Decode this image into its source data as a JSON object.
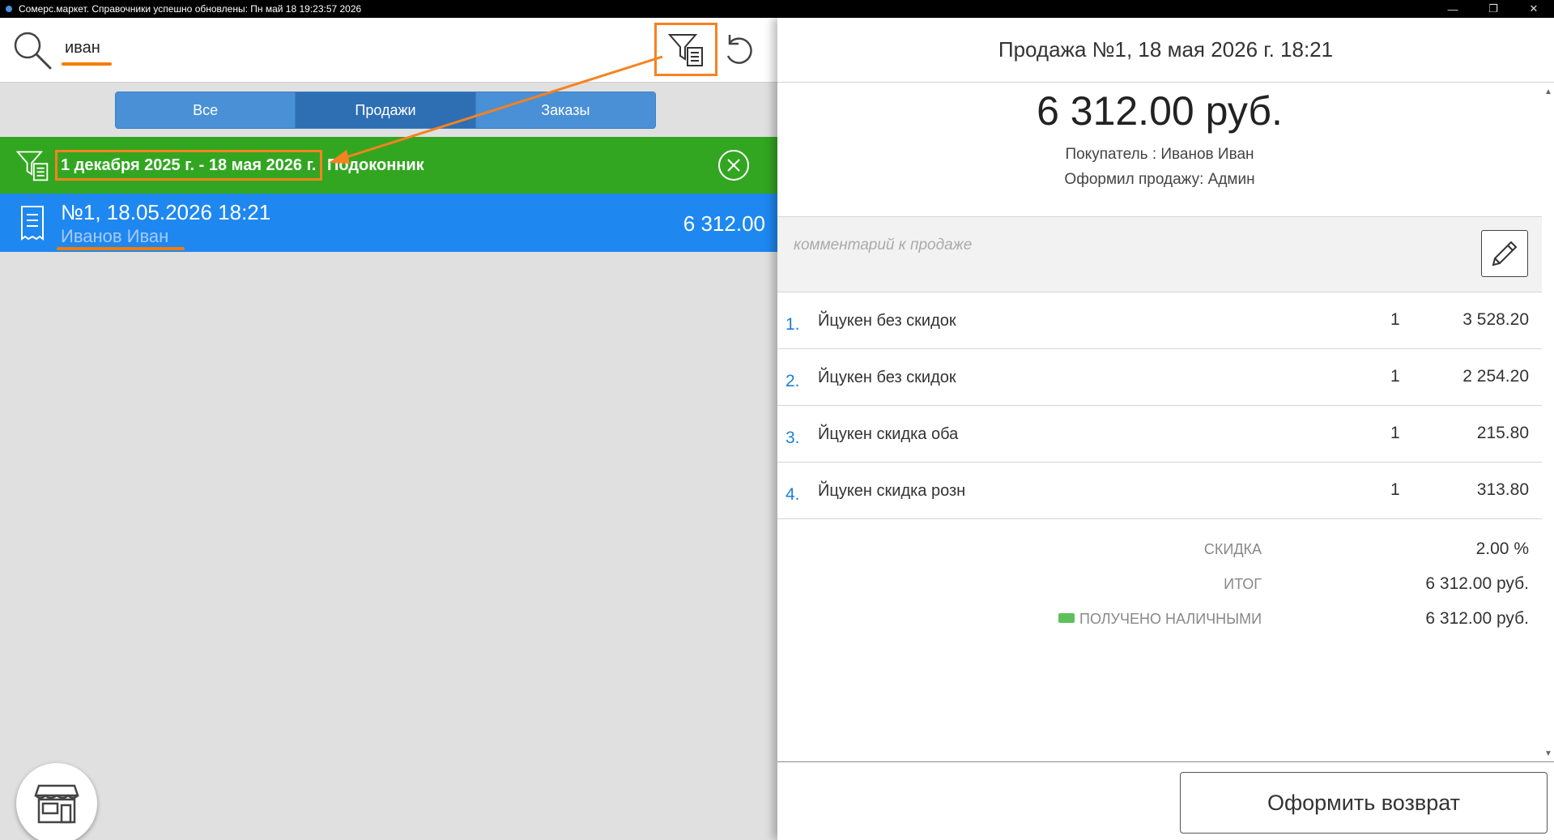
{
  "window": {
    "title": "Сомерс.маркет. Справочники успешно обновлены: Пн май 18 19:23:57 2026",
    "minimize": "—",
    "maximize": "❐",
    "close": "✕"
  },
  "search": {
    "query": "иван"
  },
  "tabs": [
    {
      "label": "Все",
      "active": false
    },
    {
      "label": "Продажи",
      "active": true
    },
    {
      "label": "Заказы",
      "active": false
    }
  ],
  "filter": {
    "date_range": "1 декабря 2025 г. - 18 мая 2026 г.",
    "place": "Подоконник"
  },
  "sale_list": [
    {
      "title": "№1, 18.05.2026 18:21",
      "buyer": "Иванов Иван",
      "sum": "6 312.00"
    }
  ],
  "detail": {
    "header": "Продажа №1, 18 мая 2026 г. 18:21",
    "total": "6 312.00 руб.",
    "buyer": "Покупатель : Иванов Иван",
    "seller": "Оформил продажу: Админ",
    "comment_placeholder": "комментарий к продаже",
    "items": [
      {
        "num": "1.",
        "name": "Йцукен без скидок",
        "qty": "1",
        "sum": "3 528.20"
      },
      {
        "num": "2.",
        "name": "Йцукен без скидок",
        "qty": "1",
        "sum": "2 254.20"
      },
      {
        "num": "3.",
        "name": "Йцукен скидка оба",
        "qty": "1",
        "sum": "215.80"
      },
      {
        "num": "4.",
        "name": "Йцукен скидка розн",
        "qty": "1",
        "sum": "313.80"
      }
    ],
    "summary": {
      "discount_label": "СКИДКА",
      "discount_value": "2.00 %",
      "total_label": "ИТОГ",
      "total_value": "6 312.00 руб.",
      "cash_label": "ПОЛУЧЕНО НАЛИЧНЫМИ",
      "cash_value": "6 312.00 руб."
    },
    "return_button": "Оформить возврат"
  },
  "colors": {
    "accent_orange": "#f58220",
    "filter_green": "#32a620",
    "selected_blue": "#1e88f0",
    "tab_blue": "#4a90d6"
  }
}
